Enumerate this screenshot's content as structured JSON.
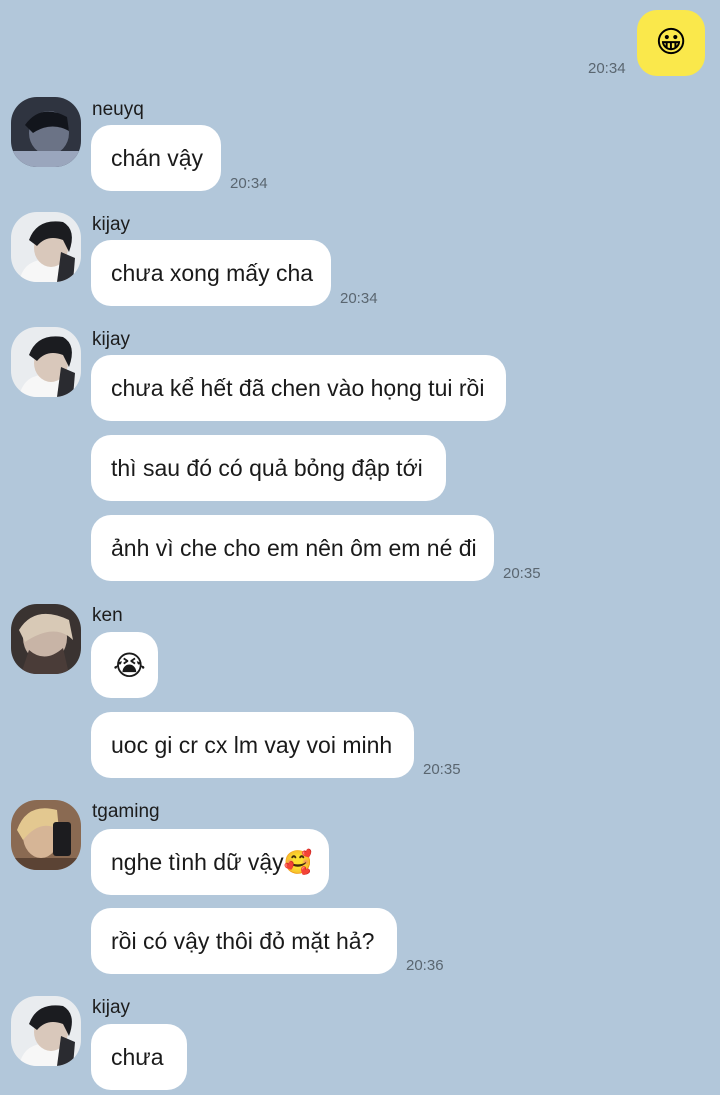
{
  "outgoing": {
    "sticker": "😀",
    "time": "20:34"
  },
  "groups": [
    {
      "sender": "neuyq",
      "avatar_icon": "profile-photo-dark",
      "messages": [
        {
          "text": "chán vậy",
          "time": "20:34"
        }
      ]
    },
    {
      "sender": "kijay",
      "avatar_icon": "profile-photo-boy-white-shirt",
      "messages": [
        {
          "text": "chưa xong mấy cha",
          "time": "20:34"
        }
      ]
    },
    {
      "sender": "kijay",
      "avatar_icon": "profile-photo-boy-white-shirt",
      "messages": [
        {
          "text": "chưa kể hết đã chen vào họng tui rồi",
          "time": ""
        },
        {
          "text": "thì sau đó có quả bỏng đập tới",
          "time": ""
        },
        {
          "text": "ảnh vì che cho em nên ôm em né đi",
          "time": "20:35"
        }
      ]
    },
    {
      "sender": "ken",
      "avatar_icon": "profile-photo-blond",
      "messages": [
        {
          "text": "😭",
          "time": ""
        },
        {
          "text": "uoc gi cr cx lm vay voi minh",
          "time": "20:35"
        }
      ]
    },
    {
      "sender": "tgaming",
      "avatar_icon": "profile-photo-mirror-selfie",
      "messages": [
        {
          "text": "nghe tình dữ vậy🥰",
          "time": ""
        },
        {
          "text": "rồi có vậy thôi đỏ mặt hả?",
          "time": "20:36"
        }
      ]
    },
    {
      "sender": "kijay",
      "avatar_icon": "profile-photo-boy-white-shirt",
      "messages": [
        {
          "text": "chưa",
          "time": ""
        }
      ]
    }
  ],
  "colors": {
    "background": "#b2c7da",
    "incoming_bubble": "#ffffff",
    "outgoing_bubble": "#fae84b",
    "timestamp": "#5a6670"
  }
}
